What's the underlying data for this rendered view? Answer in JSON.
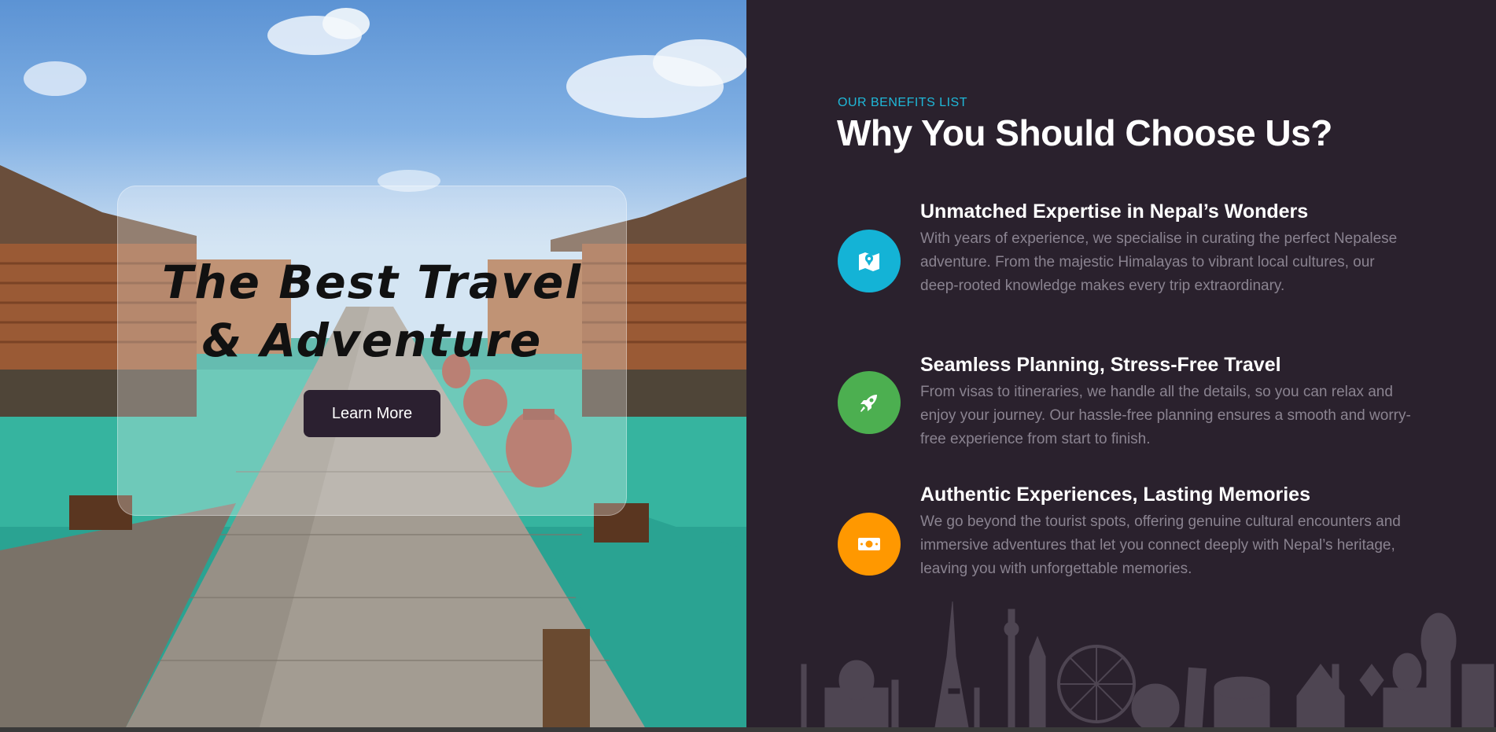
{
  "hero": {
    "title_line1": "The Best Travel",
    "title_line2": "& Adventure",
    "button_label": "Learn More"
  },
  "benefits_section": {
    "eyebrow": "OUR BENEFITS LIST",
    "heading": "Why You Should Choose Us?",
    "items": [
      {
        "title": "Unmatched Expertise in Nepal’s Wonders",
        "description": "With years of experience, we specialise in curating the perfect Nepalese adventure. From the majestic Himalayas to vibrant local cultures, our deep-rooted knowledge makes every trip extraordinary.",
        "icon": "map-pin-icon",
        "color": "#14b3d6"
      },
      {
        "title": "Seamless Planning, Stress-Free Travel",
        "description": "From visas to itineraries, we handle all the details, so you can relax and enjoy your journey. Our hassle-free planning ensures a smooth and worry-free experience from start to finish.",
        "icon": "rocket-icon",
        "color": "#4caf50"
      },
      {
        "title": "Authentic Experiences, Lasting Memories",
        "description": "We go beyond the tourist spots, offering genuine cultural encounters and immersive adventures that let you connect deeply with Nepal’s heritage, leaving you with unforgettable memories.",
        "icon": "money-bill-icon",
        "color": "#ff9800"
      }
    ]
  },
  "colors": {
    "panel_bg": "#2a212d",
    "accent": "#1fb8d8",
    "button_bg": "#2b2030"
  }
}
